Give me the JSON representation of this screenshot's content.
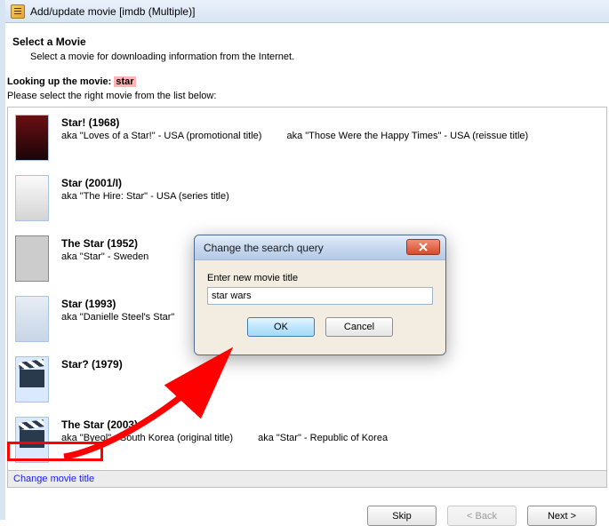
{
  "window": {
    "title": "Add/update movie [imdb (Multiple)]"
  },
  "header": {
    "title": "Select a Movie",
    "description": "Select a movie for downloading information from the Internet."
  },
  "lookup": {
    "prefix": "Looking up the movie:",
    "term": "star",
    "instruction": "Please select the right movie from the list below:"
  },
  "results": [
    {
      "title": "Star! (1968)",
      "aka": "aka \"Loves of a Star!\" - USA (promotional title)",
      "aka2": "aka \"Those Were the Happy Times\" - USA (reissue title)"
    },
    {
      "title": "Star (2001/I)",
      "aka": "aka \"The Hire: Star\" - USA (series title)",
      "aka2": ""
    },
    {
      "title": "The Star (1952)",
      "aka": "aka  \"Star\" - Sweden",
      "aka2": ""
    },
    {
      "title": "Star (1993)",
      "aka": "aka \"Danielle Steel's Star\"",
      "aka2": ""
    },
    {
      "title": "Star? (1979)",
      "aka": "",
      "aka2": ""
    },
    {
      "title": "The Star (2003)",
      "aka": "aka \"Byeol\" - South Korea (original title)",
      "aka2": "aka  \"Star\" - Republic of Korea"
    }
  ],
  "footer_link": "Change movie title",
  "buttons": {
    "skip": "Skip",
    "back": "< Back",
    "next": "Next >"
  },
  "modal": {
    "title": "Change the search query",
    "label": "Enter new movie title",
    "value": "star wars",
    "ok": "OK",
    "cancel": "Cancel"
  }
}
